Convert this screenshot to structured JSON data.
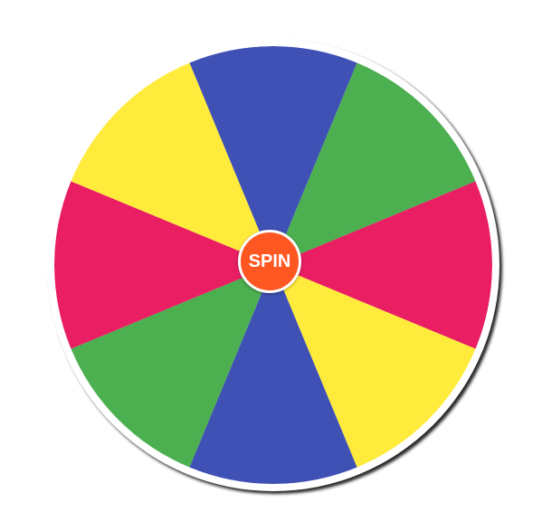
{
  "wheel": {
    "segments": [
      {
        "color": "#3F51B5"
      },
      {
        "color": "#4CAF50"
      },
      {
        "color": "#E91E63"
      },
      {
        "color": "#FFEB3B"
      },
      {
        "color": "#3F51B5"
      },
      {
        "color": "#4CAF50"
      },
      {
        "color": "#E91E63"
      },
      {
        "color": "#FFEB3B"
      }
    ],
    "spin_button": {
      "label": "SPIN",
      "color": "#FF5722"
    }
  }
}
